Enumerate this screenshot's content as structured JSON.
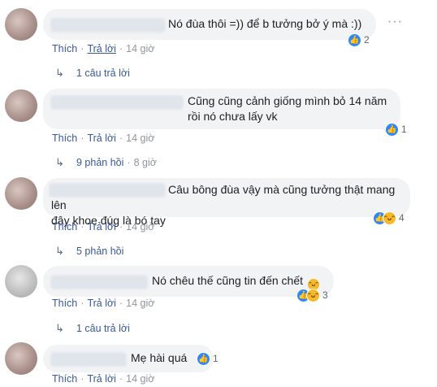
{
  "comments": [
    {
      "text": "Nó đùa thôi =)) để b tưởng bở ý mà :))",
      "like": "Thích",
      "reply": "Trả lời",
      "time": "14 giờ",
      "reactions": "2",
      "replies": "1 câu trả lời",
      "replies_time": ""
    },
    {
      "text": "Cũng cũng cảnh giống mình bỏ 14 năm\nrồi nó chưa lấy vk",
      "like": "Thích",
      "reply": "Trả lời",
      "time": "14 giờ",
      "reactions": "1",
      "replies": "9 phản hồi",
      "replies_time": "8 giờ"
    },
    {
      "text": "Câu bông đùa vậy mà cũng tưởng thật mang lên\nđây khoe đúg là bó tay",
      "like": "Thích",
      "reply": "Trả lời",
      "time": "14 giờ",
      "reactions": "4",
      "replies": "5 phản hồi",
      "replies_time": ""
    },
    {
      "text": "Nó chêu thế cũng tin đến chết",
      "like": "Thích",
      "reply": "Trả lời",
      "time": "14 giờ",
      "reactions": "3",
      "replies": "1 câu trả lời",
      "replies_time": ""
    },
    {
      "text": "Mẹ hài quá",
      "like": "Thích",
      "reply": "Trả lời",
      "time": "14 giờ",
      "reactions": "1",
      "replies": "",
      "replies_time": ""
    }
  ],
  "icons": {
    "like": "thumbs-up-icon",
    "haha": "haha-icon",
    "more": "more-dots-icon",
    "reply_arrow": "reply-arrow-icon",
    "emoji": "rofl-emoji-icon"
  },
  "colors": {
    "link": "#385898",
    "bubble": "#f2f3f5",
    "like_blue": "#2d88ff",
    "haha_yellow": "#f7b928"
  }
}
